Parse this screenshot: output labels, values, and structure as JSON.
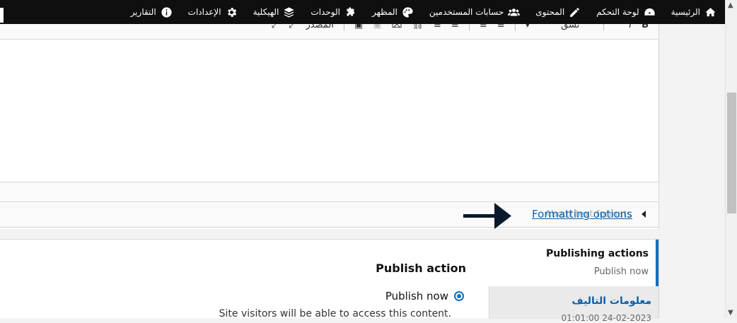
{
  "toolbar": {
    "items": [
      {
        "label": "الرئيسية",
        "icon": "home-icon"
      },
      {
        "label": "لوحة التحكم",
        "icon": "dashboard-icon"
      },
      {
        "label": "المحتوى",
        "icon": "pencil-icon"
      },
      {
        "label": "حسابات المستخدمين",
        "icon": "users-icon"
      },
      {
        "label": "المظهر",
        "icon": "palette-icon"
      },
      {
        "label": "الوحدات",
        "icon": "puzzle-icon"
      },
      {
        "label": "الهيكلية",
        "icon": "layers-icon"
      },
      {
        "label": "الإعدادات",
        "icon": "gear-icon"
      },
      {
        "label": "التقارير",
        "icon": "info-icon"
      }
    ]
  },
  "editor": {
    "toolbar_tools": [
      "B",
      "I",
      "❞",
      "نسق",
      "▾",
      "≡",
      "≡",
      "≡",
      "≡",
      "⛓",
      "⌧",
      "▣",
      "▣",
      "المصدر",
      "⤢"
    ]
  },
  "format": {
    "link_label": "Formatting options",
    "ghost_label": "About text formats"
  },
  "sidebar": {
    "active_title": "Publishing actions",
    "active_sub": "Publish now",
    "second_title": "معلومات التاليف",
    "second_sub": "01:01:00 24-02-2023"
  },
  "pane": {
    "title": "Publish action",
    "radio_label": "Publish now",
    "radio_desc": "Site visitors will be able to access this content."
  },
  "colors": {
    "toolbar_bg": "#0f0f0f",
    "link": "#0a5fa8",
    "accent": "#0a6fc4"
  }
}
